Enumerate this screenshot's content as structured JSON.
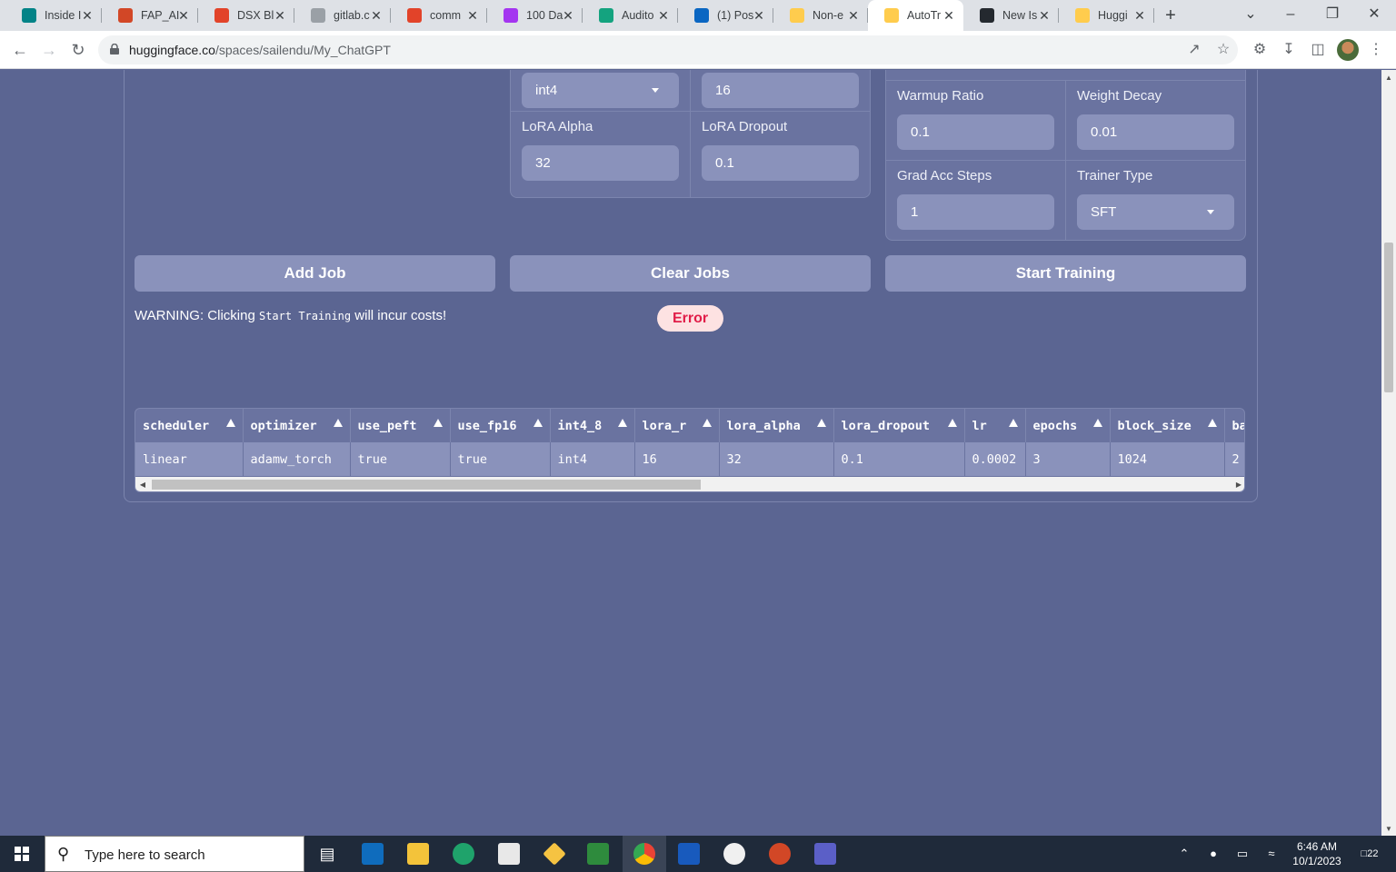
{
  "browser": {
    "tabs": [
      {
        "title": "Inside I",
        "icon": "sharepoint-icon",
        "color": "#038387"
      },
      {
        "title": "FAP_AI",
        "icon": "powerpoint-icon",
        "color": "#d24726"
      },
      {
        "title": "DSX Bl",
        "icon": "gitlab-icon",
        "color": "#e24329"
      },
      {
        "title": "gitlab.c",
        "icon": "gitlab-gray-icon",
        "color": "#9aa0a6"
      },
      {
        "title": "comm",
        "icon": "gitlab-icon",
        "color": "#e24329"
      },
      {
        "title": "100 Da",
        "icon": "udemy-icon",
        "color": "#a435f0"
      },
      {
        "title": "Audito",
        "icon": "auditor-icon",
        "color": "#14a37f"
      },
      {
        "title": "(1) Pos",
        "icon": "linkedin-icon",
        "color": "#0a66c2"
      },
      {
        "title": "Non-e",
        "icon": "huggingface-icon",
        "color": "#ffcc4d"
      },
      {
        "title": "AutoTr",
        "icon": "huggingface-icon",
        "color": "#ffcc4d",
        "active": true
      },
      {
        "title": "New Is",
        "icon": "github-icon",
        "color": "#24292f"
      },
      {
        "title": "Huggi",
        "icon": "huggingface-icon",
        "color": "#ffcc4d"
      }
    ],
    "url_host": "huggingface.co",
    "url_path": "/spaces/sailendu/My_ChatGPT"
  },
  "form": {
    "quantization_value": "int4",
    "lora_r_value": "16",
    "lora_alpha_label": "LoRA Alpha",
    "lora_alpha_value": "32",
    "lora_dropout_label": "LoRA Dropout",
    "lora_dropout_value": "0.1",
    "warmup_ratio_label": "Warmup Ratio",
    "warmup_ratio_value": "0.1",
    "weight_decay_label": "Weight Decay",
    "weight_decay_value": "0.01",
    "grad_acc_label": "Grad Acc Steps",
    "grad_acc_value": "1",
    "trainer_type_label": "Trainer Type",
    "trainer_type_value": "SFT"
  },
  "actions": {
    "add_job": "Add Job",
    "clear_jobs": "Clear Jobs",
    "start_training": "Start Training"
  },
  "warning": {
    "prefix": "WARNING: Clicking ",
    "code": "Start Training",
    "suffix": " will incur costs!"
  },
  "status": {
    "error_label": "Error",
    "error_color": "#e11d48"
  },
  "jobs_table": {
    "columns": [
      "scheduler",
      "optimizer",
      "use_peft",
      "use_fp16",
      "int4_8",
      "lora_r",
      "lora_alpha",
      "lora_dropout",
      "lr",
      "epochs",
      "block_size",
      "ba"
    ],
    "rows": [
      [
        "linear",
        "adamw_torch",
        "true",
        "true",
        "int4",
        "16",
        "32",
        "0.1",
        "0.0002",
        "3",
        "1024",
        "2"
      ]
    ]
  },
  "taskbar": {
    "search_placeholder": "Type here to search",
    "time": "6:46 AM",
    "date": "10/1/2023",
    "notification_count": "22"
  }
}
